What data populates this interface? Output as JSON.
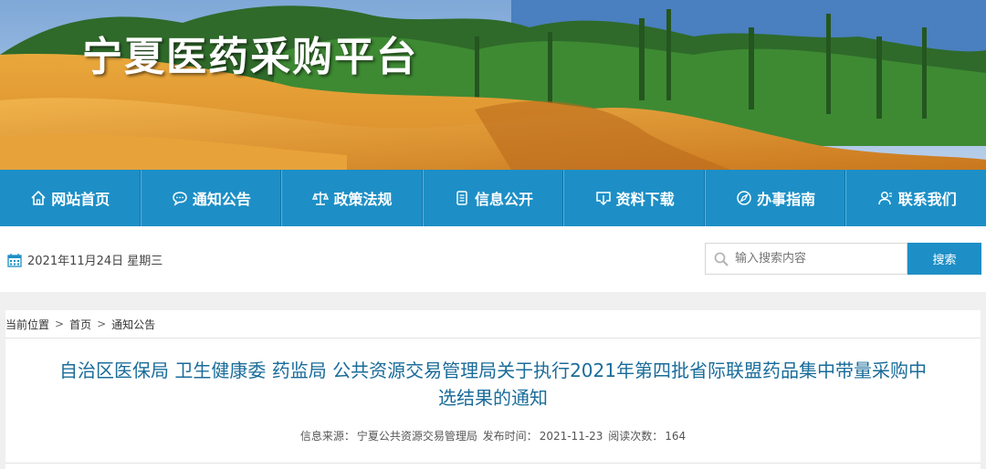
{
  "banner": {
    "title": "宁夏医药采购平台"
  },
  "nav": {
    "items": [
      {
        "label": "网站首页",
        "icon": "home-icon"
      },
      {
        "label": "通知公告",
        "icon": "chat-icon"
      },
      {
        "label": "政策法规",
        "icon": "scales-icon"
      },
      {
        "label": "信息公开",
        "icon": "document-icon"
      },
      {
        "label": "资料下载",
        "icon": "download-icon"
      },
      {
        "label": "办事指南",
        "icon": "compass-icon"
      },
      {
        "label": "联系我们",
        "icon": "contacts-icon"
      }
    ]
  },
  "infobar": {
    "date": "2021年11月24日 星期三",
    "search_placeholder": "输入搜索内容",
    "search_button": "搜索"
  },
  "breadcrumb": {
    "prefix": "当前位置",
    "sep": ">",
    "items": [
      "首页",
      "通知公告"
    ]
  },
  "article": {
    "title_line1": "自治区医保局 卫生健康委 药监局 公共资源交易管理局关于执行2021年第四批省际联盟药品集中带量采购中",
    "title_line2": "选结果的通知",
    "source_label": "信息来源：",
    "source": "宁夏公共资源交易管理局",
    "publish_label": "发布时间：",
    "publish_date": "2021-11-23",
    "views_label": "阅读次数：",
    "views": "164"
  },
  "colors": {
    "accent": "#1d8fc6",
    "title": "#1a6c9a"
  }
}
